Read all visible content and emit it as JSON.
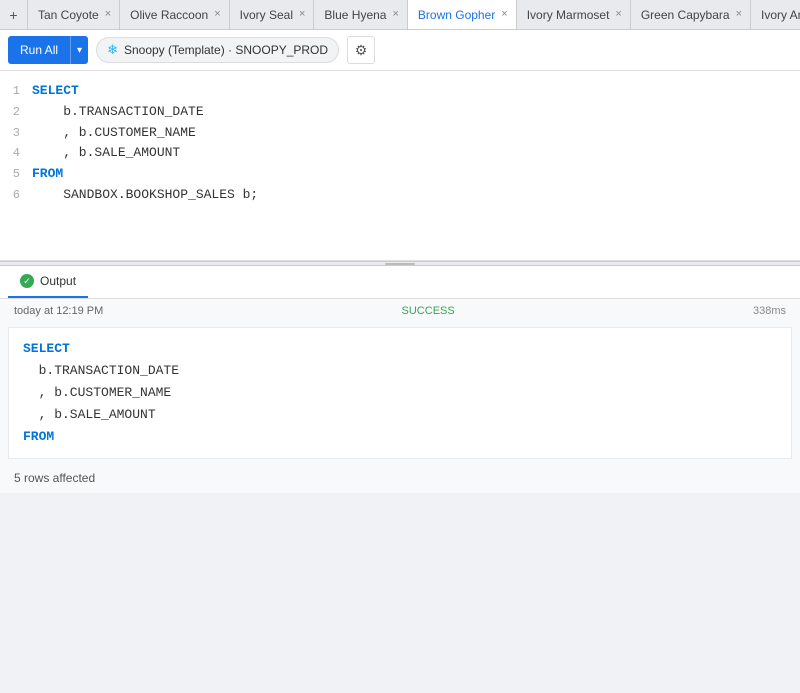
{
  "tabs": [
    {
      "id": "tan-coyote",
      "label": "Tan Coyote",
      "active": false
    },
    {
      "id": "olive-raccoon",
      "label": "Olive Raccoon",
      "active": false
    },
    {
      "id": "ivory-seal",
      "label": "Ivory Seal",
      "active": false
    },
    {
      "id": "blue-hyena",
      "label": "Blue Hyena",
      "active": false
    },
    {
      "id": "brown-gopher",
      "label": "Brown Gopher",
      "active": true
    },
    {
      "id": "ivory-marmoset",
      "label": "Ivory Marmoset",
      "active": false
    },
    {
      "id": "green-capybara",
      "label": "Green Capybara",
      "active": false
    },
    {
      "id": "ivory-antelope",
      "label": "Ivory Antelope",
      "active": false
    }
  ],
  "toolbar": {
    "run_all_label": "Run All",
    "dropdown_arrow": "▾",
    "template_name": "Snoopy (Template) · SNOOPY_PROD",
    "gear_icon": "⚙"
  },
  "editor": {
    "lines": [
      {
        "num": "1",
        "tokens": [
          {
            "type": "kw",
            "text": "SELECT"
          }
        ]
      },
      {
        "num": "2",
        "tokens": [
          {
            "type": "indent",
            "text": "    b.TRANSACTION_DATE"
          }
        ]
      },
      {
        "num": "3",
        "tokens": [
          {
            "type": "indent",
            "text": "  , b.CUSTOMER_NAME"
          }
        ]
      },
      {
        "num": "4",
        "tokens": [
          {
            "type": "indent",
            "text": "  , b.SALE_AMOUNT"
          }
        ]
      },
      {
        "num": "5",
        "tokens": [
          {
            "type": "kw",
            "text": "FROM"
          }
        ]
      },
      {
        "num": "6",
        "tokens": [
          {
            "type": "indent",
            "text": "    SANDBOX.BOOKSHOP_SALES b;"
          }
        ]
      }
    ]
  },
  "output": {
    "tab_label": "Output",
    "result": {
      "timestamp": "today at 12:19 PM",
      "status": "SUCCESS",
      "duration": "338ms",
      "query_lines": [
        {
          "type": "kw",
          "text": "SELECT"
        },
        {
          "type": "indent",
          "text": "  b.TRANSACTION_DATE"
        },
        {
          "type": "indent",
          "text": "  , b.CUSTOMER_NAME"
        },
        {
          "type": "indent",
          "text": "  , b.SALE_AMOUNT"
        },
        {
          "type": "kw",
          "text": "FROM"
        }
      ],
      "rows_affected": "5 rows affected"
    }
  },
  "icons": {
    "add": "+",
    "close": "×",
    "snowflake": "❄",
    "check": "✓",
    "chevron_down": "▾"
  }
}
